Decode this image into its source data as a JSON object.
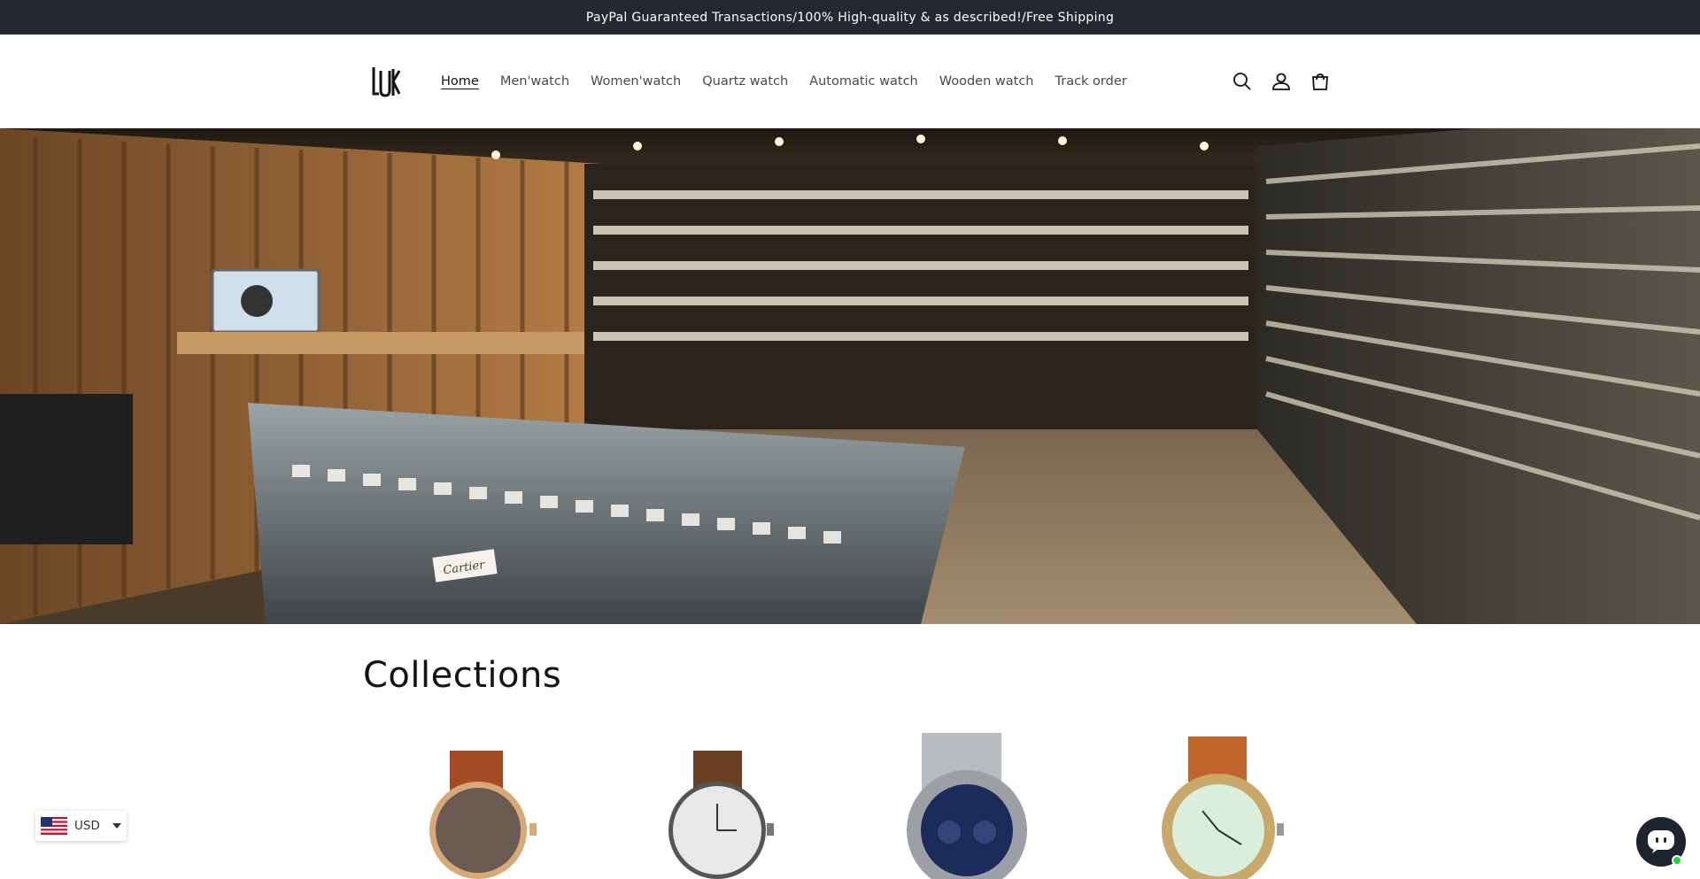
{
  "announcement": {
    "text": "PayPal Guaranteed Transactions/100% High-quality & as described!/Free Shipping"
  },
  "header": {
    "logo_icon": "lux-logo",
    "nav": [
      {
        "label": "Home",
        "active": true
      },
      {
        "label": "Men'watch",
        "active": false
      },
      {
        "label": "Women'watch",
        "active": false
      },
      {
        "label": "Quartz watch",
        "active": false
      },
      {
        "label": "Automatic watch",
        "active": false
      },
      {
        "label": "Wooden watch",
        "active": false
      },
      {
        "label": "Track order",
        "active": false
      }
    ],
    "icons": [
      "search-icon",
      "account-icon",
      "cart-icon"
    ]
  },
  "hero": {
    "image": "watch-store-interior",
    "sign_text": "Cartier"
  },
  "collections": {
    "title": "Collections",
    "items": [
      {
        "image": "brown-leather-rose-gold-watch"
      },
      {
        "image": "white-dial-brown-strap-watch"
      },
      {
        "image": "blue-chronograph-steel-watch"
      },
      {
        "image": "wooden-green-dial-watch"
      }
    ]
  },
  "currency": {
    "code": "USD",
    "flag": "us-flag"
  },
  "chat": {
    "icon": "chat-icon",
    "status_color": "#2ecc40"
  },
  "colors": {
    "announcement_bg": "#242833",
    "text": "#121212",
    "chat_bg": "#1c2430"
  }
}
